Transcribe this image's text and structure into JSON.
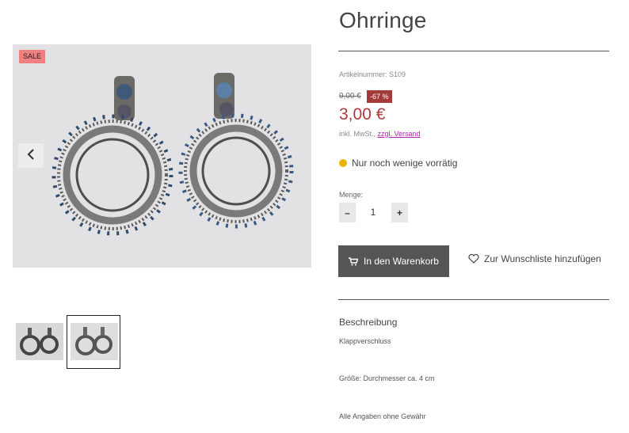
{
  "gallery": {
    "sale_badge": "SALE",
    "prev_arrow_icon": "chevron-left-icon",
    "thumbnails": [
      "earrings-thumbnail-1",
      "earrings-thumbnail-2"
    ],
    "selected_thumbnail": 2
  },
  "product": {
    "title": "Ohrringe",
    "article_number": "Artikelnummer: S109",
    "old_price": "9,00 €",
    "discount": "-67 %",
    "price": "3,00 €",
    "tax_prefix": "inkl. MwSt., ",
    "shipping_link": "zzgl. Versand",
    "stock": "Nur noch wenige vorrätig",
    "stock_color": "#e8b400",
    "price_color": "#b03a3a"
  },
  "quantity": {
    "label": "Menge:",
    "minus": "–",
    "value": "1",
    "plus": "+"
  },
  "actions": {
    "cart_label": "In den Warenkorb",
    "cart_icon": "cart-icon",
    "wishlist_label": "Zur Wunschliste hinzufügen",
    "wishlist_icon": "heart-icon"
  },
  "description": {
    "heading": "Beschreibung",
    "lines": [
      "Klappverschluss",
      "Größe: Durchmesser ca. 4 cm",
      "Alle Angaben ohne Gewähr"
    ]
  }
}
